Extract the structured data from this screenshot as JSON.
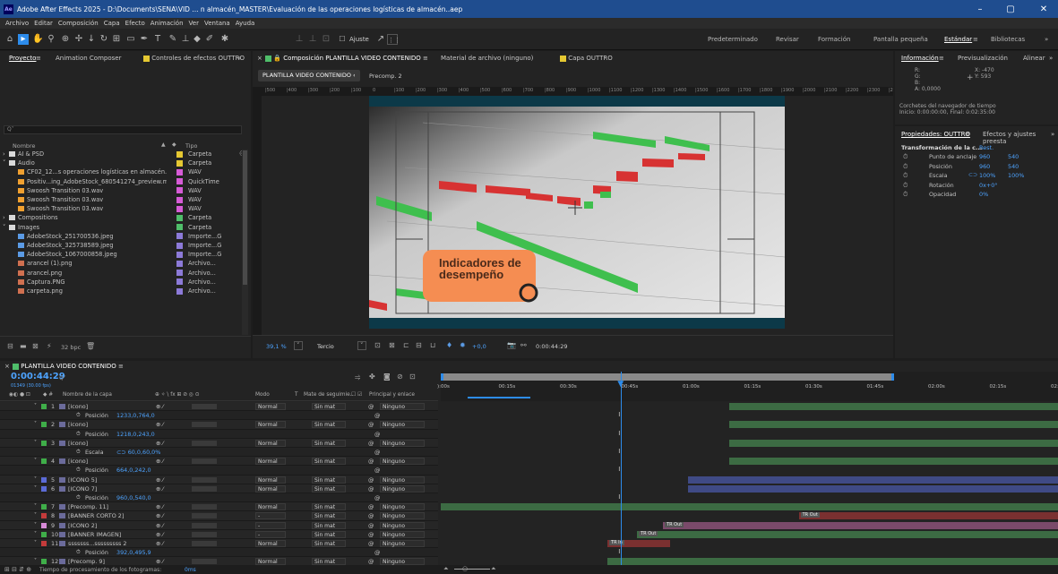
{
  "window": {
    "title": "Adobe After Effects 2025 - D:\\Documents\\SENA\\VID ... n almacén_MASTER\\Evaluación de las operaciones logísticas de almacén..aep",
    "logo": "Ae",
    "min": "–",
    "max": "▢",
    "close": "✕"
  },
  "menu": [
    "Archivo",
    "Editar",
    "Composición",
    "Capa",
    "Efecto",
    "Animación",
    "Ver",
    "Ventana",
    "Ayuda"
  ],
  "toolbar": {
    "align_label": "Ajuste",
    "workspaces": [
      "Predeterminado",
      "Revisar",
      "Formación",
      "Pantalla pequeña",
      "Estándar",
      "Bibliotecas"
    ],
    "active_workspace": "Estándar",
    "more": "»"
  },
  "project_panel": {
    "tabs": [
      "Proyecto",
      "Animation Composer",
      "Controles de efectos OUTTRO"
    ],
    "search_placeholder": "Q˅",
    "col_name": "Nombre",
    "col_type": "Tipo",
    "bpc": "32 bpc",
    "items": [
      {
        "name": "AI & PSD",
        "type": "Carpeta",
        "color": "#e5c832",
        "indent": 0,
        "icon": "folder",
        "arrow": "›"
      },
      {
        "name": "Audio",
        "type": "Carpeta",
        "color": "#e5c832",
        "indent": 0,
        "icon": "folder",
        "arrow": "˅"
      },
      {
        "name": "CF02_12...s operaciones logísticas en almacén.wav",
        "type": "WAV",
        "color": "#d65bd6",
        "indent": 1,
        "icon": "audio"
      },
      {
        "name": "Positiv...ing_AdobeStock_680541274_preview.m4a",
        "type": "QuickTime",
        "color": "#d65bd6",
        "indent": 1,
        "icon": "audio"
      },
      {
        "name": "Swoosh Transition 03.wav",
        "type": "WAV",
        "color": "#d65bd6",
        "indent": 1,
        "icon": "audio"
      },
      {
        "name": "Swoosh Transition 03.wav",
        "type": "WAV",
        "color": "#d65bd6",
        "indent": 1,
        "icon": "audio"
      },
      {
        "name": "Swoosh Transition 03.wav",
        "type": "WAV",
        "color": "#d65bd6",
        "indent": 1,
        "icon": "audio"
      },
      {
        "name": "Compositions",
        "type": "Carpeta",
        "color": "#4fbe6a",
        "indent": 0,
        "icon": "folder",
        "arrow": "›"
      },
      {
        "name": "Images",
        "type": "Carpeta",
        "color": "#4fbe6a",
        "indent": 0,
        "icon": "folder",
        "arrow": "˅"
      },
      {
        "name": "AdobeStock_251700536.jpeg",
        "type": "Importe...G",
        "color": "#8c7ad8",
        "indent": 1,
        "icon": "image"
      },
      {
        "name": "AdobeStock_325738589.jpeg",
        "type": "Importe...G",
        "color": "#8c7ad8",
        "indent": 1,
        "icon": "image"
      },
      {
        "name": "AdobeStock_1067000858.jpeg",
        "type": "Importe...G",
        "color": "#8c7ad8",
        "indent": 1,
        "icon": "image"
      },
      {
        "name": "arancel (1).png",
        "type": "Archivo...",
        "color": "#8c7ad8",
        "indent": 1,
        "icon": "png"
      },
      {
        "name": "arancel.png",
        "type": "Archivo...",
        "color": "#8c7ad8",
        "indent": 1,
        "icon": "png"
      },
      {
        "name": "Captura.PNG",
        "type": "Archivo...",
        "color": "#8c7ad8",
        "indent": 1,
        "icon": "png"
      },
      {
        "name": "carpeta.png",
        "type": "Archivo...",
        "color": "#8c7ad8",
        "indent": 1,
        "icon": "png"
      }
    ]
  },
  "comp_panel": {
    "tab_label": "Composición PLANTILLA VIDEO CONTENIDO",
    "footage_tab": "Material de archivo (ninguno)",
    "layer_tab": "Capa OUTTRO",
    "breadcrumbs": [
      "PLANTILLA VIDEO CONTENIDO",
      "Precomp. 2"
    ],
    "zoom": "39,1 %",
    "resolution": "Tercio",
    "exposure": "+0,0",
    "timecode": "0:00:44:29",
    "overlay_text": "Indicadores de desempeño",
    "ruler_labels": [
      "|500",
      "|400",
      "|300",
      "|200",
      "|100",
      "0",
      "|100",
      "|200",
      "|300",
      "|400",
      "|500",
      "|600",
      "|700",
      "|800",
      "|900",
      "|1000",
      "|1100",
      "|1200",
      "|1300",
      "|1400",
      "|1500",
      "|1600",
      "|1700",
      "|1800",
      "|1900",
      "|2000",
      "|2100",
      "|2200",
      "|2300",
      "|24"
    ]
  },
  "info_panel": {
    "tabs": [
      "Información",
      "Previsualización",
      "Alinear"
    ],
    "r": "R:",
    "g": "G:",
    "b": "B:",
    "a": "A: 0,0000",
    "x": "X: -470",
    "y": "Y: 593",
    "bracket_title": "Corchetes del navegador de tiempo",
    "bracket_value": "Inicio: 0:00:00:00, Final: 0:02:35:00"
  },
  "properties_panel": {
    "tabs": [
      "Propiedades: OUTTRO",
      "Efectos y ajustes preesta"
    ],
    "section": "Transformación de la c...",
    "reset": "Rest.",
    "props": [
      {
        "label": "Punto de anclaje",
        "v1": "960",
        "v2": "540"
      },
      {
        "label": "Posición",
        "v1": "960",
        "v2": "540"
      },
      {
        "label": "Escala",
        "v1": "100%",
        "v2": "100%",
        "link": "⊂⊃"
      },
      {
        "label": "Rotación",
        "v1": "0x+0°",
        "v2": ""
      },
      {
        "label": "Opacidad",
        "v1": "0%",
        "v2": ""
      }
    ]
  },
  "timeline": {
    "tab": "PLANTILLA VIDEO CONTENIDO",
    "timecode": "0:00:44:29",
    "frames": "01349 (30.00 fps)",
    "search_placeholder": "Q˅",
    "col_layer": "Nombre de la capa",
    "col_mode": "Modo",
    "col_t": "T",
    "col_track": "Mate de seguimie..",
    "col_parent": "Principal y enlace",
    "ticks": [
      "):00s",
      "00:15s",
      "00:30s",
      "00:45s",
      "01:00s",
      "01:15s",
      "01:30s",
      "01:45s",
      "02:00s",
      "02:15s",
      "02:30s"
    ],
    "playhead_fraction": 0.292,
    "footer": "Tiempo de procesamiento de los fotogramas:",
    "footer_value": "0ms",
    "rows": [
      {
        "kind": "layer",
        "num": "1",
        "name": "[icono]",
        "mode": "Normal",
        "track": "Sin mat",
        "parent": "Ninguno",
        "label": "#3fae49",
        "bar_start": 0.468,
        "bar_end": 1.0
      },
      {
        "kind": "prop",
        "name": "Posición",
        "value": "1233,0,764,0"
      },
      {
        "kind": "layer",
        "num": "2",
        "name": "[icono]",
        "mode": "Normal",
        "track": "Sin mat",
        "parent": "Ninguno",
        "label": "#3fae49",
        "bar_start": 0.468,
        "bar_end": 1.0
      },
      {
        "kind": "prop",
        "name": "Posición",
        "value": "1218,0,243,0"
      },
      {
        "kind": "layer",
        "num": "3",
        "name": "[icono]",
        "mode": "Normal",
        "track": "Sin mat",
        "parent": "Ninguno",
        "label": "#3fae49",
        "bar_start": 0.468,
        "bar_end": 1.0
      },
      {
        "kind": "prop",
        "name": "Escala",
        "value": "⊂⊃ 60,0,60,0%"
      },
      {
        "kind": "layer",
        "num": "4",
        "name": "[icono]",
        "mode": "Normal",
        "track": "Sin mat",
        "parent": "Ninguno",
        "label": "#3fae49",
        "bar_start": 0.468,
        "bar_end": 1.0
      },
      {
        "kind": "prop",
        "name": "Posición",
        "value": "664,0,242,0"
      },
      {
        "kind": "layer",
        "num": "5",
        "name": "[ICONO 5]",
        "mode": "Normal",
        "track": "Sin mat",
        "parent": "Ninguno",
        "label": "#5b6bd6",
        "bar_start": 0.4,
        "bar_end": 1.0
      },
      {
        "kind": "layer",
        "num": "6",
        "name": "[ICONO 7]",
        "mode": "Normal",
        "track": "Sin mat",
        "parent": "Ninguno",
        "label": "#5b6bd6",
        "bar_start": 0.4,
        "bar_end": 1.0
      },
      {
        "kind": "prop",
        "name": "Posición",
        "value": "960,0,540,0"
      },
      {
        "kind": "layer",
        "num": "7",
        "name": "[Precomp. 11]",
        "mode": "Normal",
        "track": "Sin mat",
        "parent": "Ninguno",
        "label": "#3fae49",
        "bar_start": 0.0,
        "bar_end": 1.0
      },
      {
        "kind": "layer",
        "num": "8",
        "name": "[BANNER CORTO 2]",
        "mode": "-",
        "track": "Sin mat",
        "parent": "Ninguno",
        "label": "#c43b3b",
        "bar_start": 0.58,
        "bar_end": 1.0,
        "marker": "TR Out"
      },
      {
        "kind": "layer",
        "num": "9",
        "name": "[ICONO 2]",
        "mode": "-",
        "track": "Sin mat",
        "parent": "Ninguno",
        "label": "#d88bd8",
        "bar_start": 0.36,
        "bar_end": 1.0,
        "marker": "TR Out"
      },
      {
        "kind": "layer",
        "num": "10",
        "name": "[BANNER IMAGEN]",
        "mode": "-",
        "track": "Sin mat",
        "parent": "Ninguno",
        "label": "#3fae49",
        "bar_start": 0.318,
        "bar_end": 1.0,
        "marker": "TR Out"
      },
      {
        "kind": "layer",
        "num": "11",
        "name": "sssssss...sssssssss 2",
        "mode": "Normal",
        "track": "Sin mat",
        "parent": "Ninguno",
        "label": "#c43b3b",
        "bar_start": 0.27,
        "bar_end": 0.372,
        "marker": "TR In"
      },
      {
        "kind": "prop",
        "name": "Posición",
        "value": "392,0,495,9"
      },
      {
        "kind": "layer",
        "num": "12",
        "name": "[Precomp. 9]",
        "mode": "Normal",
        "track": "Sin mat",
        "parent": "Ninguno",
        "label": "#3fae49",
        "bar_start": 0.27,
        "bar_end": 1.0
      },
      {
        "kind": "prop",
        "name": "Posición",
        "value": "405,3,535,7"
      }
    ]
  },
  "colors": {
    "accent_blue": "#2d8ceb",
    "layer_green": "#3c6b43",
    "layer_blue": "#3f4a85",
    "layer_pink": "#7a4a6a",
    "layer_red": "#7a3030",
    "orange_overlay": "#f58d52"
  }
}
